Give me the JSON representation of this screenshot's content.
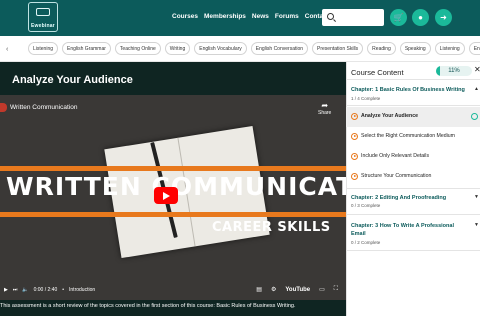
{
  "header": {
    "logo_text": "Ewebinar",
    "nav": [
      "Courses",
      "Memberships",
      "News",
      "Forums",
      "Contact Us"
    ],
    "search_placeholder": "",
    "icons": [
      "search-icon",
      "cart-icon",
      "user-icon",
      "logout-icon"
    ],
    "accent_color": "#1bb99a",
    "bar_color": "#0c5b5b"
  },
  "chips": [
    "Listening",
    "English Grammar",
    "Teaching Online",
    "Writing",
    "English Vocabulary",
    "English Conversation",
    "Presentation Skills",
    "Reading",
    "Speaking",
    "Listening",
    "Eng"
  ],
  "lesson": {
    "title": "Analyze Your Audience",
    "video": {
      "channel_title": "Written Communication",
      "share_label": "Share",
      "big_title": "WRITTEN COMMUNICATION",
      "subtitle": "CAREER SKILLS",
      "time": "0:00 / 2:40",
      "chapter": "Introduction",
      "brand": "YouTube"
    },
    "caption": "This assessment is a short review of the topics covered in the first section of this course: Basic Rules of Business Writing."
  },
  "course_content": {
    "heading": "Course Content",
    "progress_label": "11%",
    "progress_value": 0.11,
    "chapters": [
      {
        "title": "Chapter: 1 Basic Rules Of Business Writing",
        "sub": "1 / 4 Complete",
        "lessons": [
          {
            "label": "Analyze Your Audience",
            "active": true
          },
          {
            "label": "Select the Right Communication Medium",
            "active": false
          },
          {
            "label": "Include Only Relevant Details",
            "active": false
          },
          {
            "label": "Structure Your Communication",
            "active": false
          }
        ]
      },
      {
        "title": "Chapter: 2 Editing And Proofreading",
        "sub": "0 / 3 Complete"
      },
      {
        "title": "Chapter: 3 How To Write A Professional Email",
        "sub": "0 / 2 Complete"
      }
    ]
  }
}
